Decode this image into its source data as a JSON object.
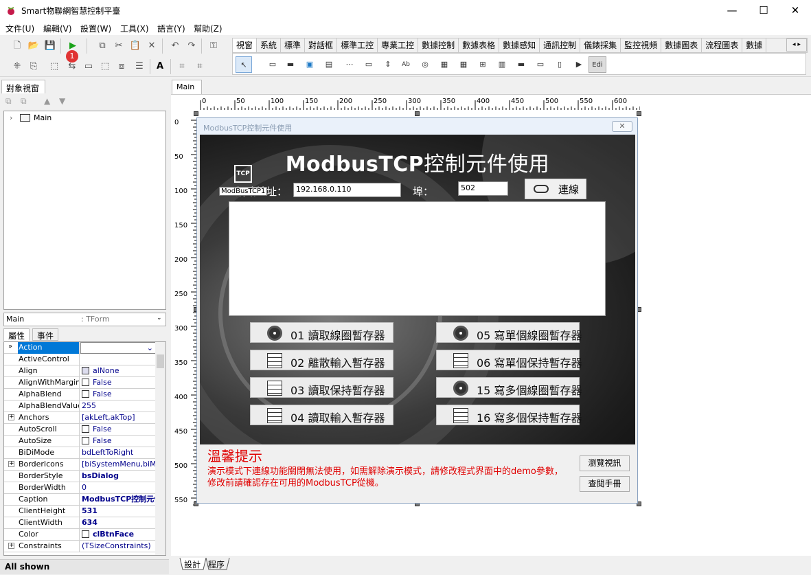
{
  "window": {
    "title": "Smart物聯網智慧控制平臺",
    "min": "—",
    "max": "☐",
    "close": "✕"
  },
  "menu": [
    "文件(U)",
    "編輯(V)",
    "設置(W)",
    "工具(X)",
    "語言(Y)",
    "幫助(Z)"
  ],
  "badge": "1",
  "component_tabs": [
    "視窗",
    "系統",
    "標準",
    "對話框",
    "標準工控",
    "專業工控",
    "數據控制",
    "數據表格",
    "數據感知",
    "通訊控制",
    "儀錶採集",
    "監控視頻",
    "數據圖表",
    "流程圖表",
    "數據"
  ],
  "palette_edit_label": "Edi",
  "left": {
    "tab": "對象視窗",
    "tree_root": "Main",
    "combo_name": "Main",
    "combo_type": ": TForm",
    "prop_tabs": [
      "屬性",
      "事件"
    ],
    "status": "All shown"
  },
  "properties": [
    {
      "name": "Action",
      "value": "",
      "expand": false,
      "check": false,
      "bold": false,
      "selected": true
    },
    {
      "name": "ActiveControl",
      "value": "",
      "expand": false,
      "check": false,
      "bold": false
    },
    {
      "name": "Align",
      "value": "alNone",
      "expand": false,
      "check": false,
      "bold": false,
      "icon": true
    },
    {
      "name": "AlignWithMargins",
      "value": "False",
      "expand": false,
      "check": true,
      "bold": false
    },
    {
      "name": "AlphaBlend",
      "value": "False",
      "expand": false,
      "check": true,
      "bold": false
    },
    {
      "name": "AlphaBlendValue",
      "value": "255",
      "expand": false,
      "check": false,
      "bold": false
    },
    {
      "name": "Anchors",
      "value": "[akLeft,akTop]",
      "expand": true,
      "check": false,
      "bold": false
    },
    {
      "name": "AutoScroll",
      "value": "False",
      "expand": false,
      "check": true,
      "bold": false
    },
    {
      "name": "AutoSize",
      "value": "False",
      "expand": false,
      "check": true,
      "bold": false
    },
    {
      "name": "BiDiMode",
      "value": "bdLeftToRight",
      "expand": false,
      "check": false,
      "bold": false
    },
    {
      "name": "BorderIcons",
      "value": "[biSystemMenu,biMinim",
      "expand": true,
      "check": false,
      "bold": false
    },
    {
      "name": "BorderStyle",
      "value": "bsDialog",
      "expand": false,
      "check": false,
      "bold": true
    },
    {
      "name": "BorderWidth",
      "value": "0",
      "expand": false,
      "check": false,
      "bold": false
    },
    {
      "name": "Caption",
      "value": "ModbusTCP控制元件",
      "expand": false,
      "check": false,
      "bold": true
    },
    {
      "name": "ClientHeight",
      "value": "531",
      "expand": false,
      "check": false,
      "bold": true
    },
    {
      "name": "ClientWidth",
      "value": "634",
      "expand": false,
      "check": false,
      "bold": true
    },
    {
      "name": "Color",
      "value": "clBtnFace",
      "expand": false,
      "check": true,
      "bold": true
    },
    {
      "name": "Constraints",
      "value": "(TSizeConstraints)",
      "expand": true,
      "check": false,
      "bold": false
    }
  ],
  "designer": {
    "tab": "Main",
    "hruler": [
      "0",
      "50",
      "100",
      "150",
      "200",
      "250",
      "300",
      "350",
      "400",
      "450",
      "500",
      "550",
      "600"
    ],
    "vruler": [
      "0",
      "50",
      "100",
      "150",
      "200",
      "250",
      "300",
      "350",
      "400",
      "450",
      "500",
      "550"
    ],
    "bottom_tabs": [
      "設計",
      "程序"
    ]
  },
  "form": {
    "caption": "ModbusTCP控制元件使用",
    "close_glyph": "✕",
    "hero_latin": "ModbusTCP",
    "hero_cjk": "控制元件使用",
    "tcp_icon": "TCP",
    "tcp_component": "ModBusTCP1",
    "addr_label": "網路地址：",
    "ip_value": "192.168.0.110",
    "port_label": "埠：",
    "port_value": "502",
    "connect_label": "連線",
    "buttons": [
      {
        "label": "01 讀取線圈暫存器",
        "icon": "disk"
      },
      {
        "label": "05 寫單個線圈暫存器",
        "icon": "disk"
      },
      {
        "label": "02 離散輸入暫存器",
        "icon": "server"
      },
      {
        "label": "06 寫單個保持暫存器",
        "icon": "server"
      },
      {
        "label": "03 讀取保持暫存器",
        "icon": "server"
      },
      {
        "label": "15 寫多個線圈暫存器",
        "icon": "disk"
      },
      {
        "label": "04 讀取輸入暫存器",
        "icon": "server"
      },
      {
        "label": "16 寫多個保持暫存器",
        "icon": "server"
      }
    ],
    "tip_title": "溫馨提示",
    "tip_body": "演示模式下連線功能關閉無法使用，如需解除演示模式，請修改程式界面中的demo參數，修改前請確認存在可用的ModbusTCP從機。",
    "browse_video": "瀏覽視訊",
    "manual": "查閱手冊"
  }
}
